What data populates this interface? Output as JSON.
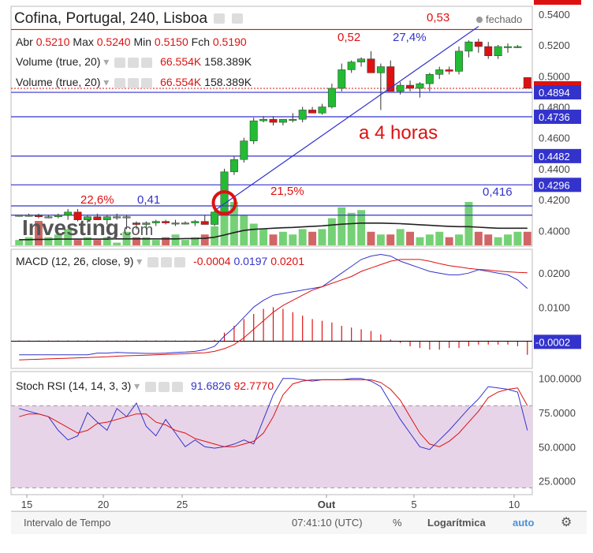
{
  "header": {
    "title": "Cofina, Portugal, 240, Lisboa",
    "status": "fechado",
    "ohlc": {
      "open_label": "Abr",
      "open": "0.5210",
      "high_label": "Max",
      "high": "0.5240",
      "low_label": "Min",
      "low": "0.5150",
      "close_label": "Fch",
      "close": "0.5190"
    },
    "volume_rows": [
      {
        "label": "Volume (true, 20)",
        "v1": "66.554K",
        "v2": "158.389K"
      },
      {
        "label": "Volume (true, 20)",
        "v1": "66.554K",
        "v2": "158.389K"
      }
    ]
  },
  "annotations": {
    "a4horas": "a 4 horas",
    "pct_left": "22,6%",
    "val_041": "0,41",
    "pct_mid": "21,5%",
    "val_0416": "0,416",
    "val_052": "0,52",
    "pct_top": "27,4%",
    "val_053": "0,53"
  },
  "price_tags": [
    {
      "value": "0.5400",
      "price": 0.54,
      "style": "red-top"
    },
    {
      "value": "0.4920",
      "price": 0.492,
      "style": "red"
    },
    {
      "value": "0.4894",
      "price": 0.4894,
      "style": "blue"
    },
    {
      "value": "0.4736",
      "price": 0.4736,
      "style": "blue"
    },
    {
      "value": "0.4482",
      "price": 0.4482,
      "style": "blue"
    },
    {
      "value": "0.4296",
      "price": 0.4296,
      "style": "blue"
    }
  ],
  "watermark": {
    "brand": "Investing",
    "suffix": ".com"
  },
  "macd": {
    "label": "MACD (12, 26, close, 9)",
    "hist": "-0.0004",
    "macd": "0.0197",
    "signal": "0.0201",
    "tag": "-0.0002"
  },
  "stoch": {
    "label": "Stoch RSI (14, 14, 3, 3)",
    "k": "91.6826",
    "d": "92.7770"
  },
  "x_ticks": [
    "15",
    "20",
    "25",
    "Out",
    "5",
    "10"
  ],
  "bottom": {
    "interval": "Intervalo de Tempo",
    "time": "07:41:10 (UTC)",
    "pct": "%",
    "log": "Logarítmica",
    "auto": "auto"
  },
  "colors": {
    "up": "#22bb33",
    "down": "#dd1111",
    "blue": "#3333cc",
    "red": "#dd1111",
    "stoch_fill": "#e8d4e8"
  },
  "chart_data": [
    {
      "type": "candlestick",
      "title": "Cofina, Portugal, 240, Lisboa",
      "ylim": [
        0.39,
        0.545
      ],
      "y_ticks": [
        0.54,
        0.52,
        0.5,
        0.48,
        0.46,
        0.44,
        0.42,
        0.4
      ],
      "h_lines": [
        0.53,
        0.4894,
        0.4736,
        0.4482,
        0.4296,
        0.416,
        0.41
      ],
      "candles": [
        [
          0.41,
          0.41,
          0.409,
          0.41
        ],
        [
          0.41,
          0.411,
          0.409,
          0.41
        ],
        [
          0.41,
          0.411,
          0.408,
          0.409
        ],
        [
          0.409,
          0.41,
          0.408,
          0.409
        ],
        [
          0.409,
          0.411,
          0.408,
          0.41
        ],
        [
          0.41,
          0.414,
          0.407,
          0.412
        ],
        [
          0.412,
          0.414,
          0.406,
          0.407
        ],
        [
          0.407,
          0.41,
          0.405,
          0.409
        ],
        [
          0.409,
          0.411,
          0.407,
          0.407
        ],
        [
          0.407,
          0.41,
          0.404,
          0.409
        ],
        [
          0.409,
          0.411,
          0.407,
          0.409
        ],
        [
          0.409,
          0.41,
          0.401,
          0.409
        ],
        [
          0.405,
          0.406,
          0.401,
          0.404
        ],
        [
          0.404,
          0.406,
          0.401,
          0.405
        ],
        [
          0.405,
          0.407,
          0.403,
          0.406
        ],
        [
          0.406,
          0.407,
          0.404,
          0.405
        ],
        [
          0.405,
          0.407,
          0.403,
          0.405
        ],
        [
          0.405,
          0.406,
          0.404,
          0.405
        ],
        [
          0.405,
          0.407,
          0.403,
          0.406
        ],
        [
          0.406,
          0.41,
          0.404,
          0.404
        ],
        [
          0.404,
          0.414,
          0.403,
          0.412
        ],
        [
          0.412,
          0.44,
          0.41,
          0.438
        ],
        [
          0.438,
          0.448,
          0.436,
          0.446
        ],
        [
          0.446,
          0.46,
          0.444,
          0.458
        ],
        [
          0.458,
          0.473,
          0.456,
          0.471
        ],
        [
          0.471,
          0.474,
          0.47,
          0.472
        ],
        [
          0.472,
          0.474,
          0.468,
          0.47
        ],
        [
          0.47,
          0.472,
          0.468,
          0.472
        ],
        [
          0.472,
          0.476,
          0.47,
          0.472
        ],
        [
          0.472,
          0.48,
          0.47,
          0.478
        ],
        [
          0.478,
          0.48,
          0.476,
          0.476
        ],
        [
          0.476,
          0.482,
          0.475,
          0.48
        ],
        [
          0.48,
          0.495,
          0.479,
          0.492
        ],
        [
          0.492,
          0.508,
          0.49,
          0.504
        ],
        [
          0.504,
          0.51,
          0.502,
          0.509
        ],
        [
          0.509,
          0.512,
          0.506,
          0.511
        ],
        [
          0.511,
          0.516,
          0.509,
          0.502
        ],
        [
          0.502,
          0.508,
          0.478,
          0.506
        ],
        [
          0.506,
          0.51,
          0.49,
          0.49
        ],
        [
          0.49,
          0.496,
          0.488,
          0.494
        ],
        [
          0.494,
          0.497,
          0.49,
          0.492
        ],
        [
          0.492,
          0.496,
          0.486,
          0.495
        ],
        [
          0.495,
          0.502,
          0.49,
          0.501
        ],
        [
          0.501,
          0.506,
          0.498,
          0.504
        ],
        [
          0.504,
          0.506,
          0.501,
          0.503
        ],
        [
          0.503,
          0.519,
          0.501,
          0.516
        ],
        [
          0.516,
          0.523,
          0.512,
          0.522
        ],
        [
          0.522,
          0.524,
          0.515,
          0.519
        ],
        [
          0.519,
          0.522,
          0.511,
          0.513
        ],
        [
          0.513,
          0.52,
          0.511,
          0.519
        ],
        [
          0.519,
          0.521,
          0.515,
          0.519
        ],
        [
          0.519,
          0.52,
          0.518,
          0.519
        ],
        [
          0.499,
          0.499,
          0.492,
          0.492
        ]
      ],
      "volume": [
        2,
        3,
        9,
        3,
        4,
        6,
        2,
        3,
        2,
        3,
        1,
        5,
        3,
        3,
        2,
        3,
        4,
        2,
        3,
        4,
        7,
        13,
        16,
        11,
        8,
        6,
        4,
        5,
        4,
        6,
        5,
        6,
        10,
        14,
        12,
        13,
        5,
        4,
        4,
        6,
        5,
        3,
        4,
        5,
        3,
        4,
        16,
        5,
        4,
        3,
        4,
        5,
        5
      ],
      "volume_ma": [
        2.1,
        2.1,
        2.2,
        2.2,
        2.3,
        2.3,
        2.3,
        2.3,
        2.3,
        2.3,
        2.4,
        2.4,
        2.4,
        2.4,
        2.4,
        2.4,
        2.4,
        2.5,
        2.5,
        2.6,
        3.0,
        3.8,
        4.7,
        5.5,
        5.9,
        6.1,
        6.3,
        6.5,
        6.6,
        6.8,
        7.0,
        7.2,
        7.5,
        7.8,
        8.0,
        8.2,
        8.2,
        8.2,
        8.1,
        8.0,
        7.8,
        7.6,
        7.4,
        7.2,
        7.0,
        6.9,
        6.9,
        6.7,
        6.5,
        6.3,
        6.3,
        6.3,
        6.3
      ]
    },
    {
      "type": "line",
      "title": "MACD (12, 26, close, 9)",
      "ylim": [
        -0.008,
        0.027
      ],
      "y_ticks": [
        0.02,
        0.01
      ],
      "macd": [
        -0.004,
        -0.004,
        -0.004,
        -0.004,
        -0.004,
        -0.004,
        -0.004,
        -0.004,
        -0.0035,
        -0.0035,
        -0.0033,
        -0.0034,
        -0.0035,
        -0.0036,
        -0.0036,
        -0.0035,
        -0.0033,
        -0.0032,
        -0.003,
        -0.0025,
        -0.0015,
        0.0015,
        0.004,
        0.007,
        0.01,
        0.012,
        0.0135,
        0.014,
        0.0145,
        0.015,
        0.0155,
        0.016,
        0.018,
        0.02,
        0.022,
        0.024,
        0.025,
        0.0255,
        0.025,
        0.0235,
        0.0225,
        0.0215,
        0.0205,
        0.02,
        0.0195,
        0.0195,
        0.02,
        0.021,
        0.0205,
        0.02,
        0.0195,
        0.018,
        0.0155
      ],
      "signal": [
        -0.0055,
        -0.0054,
        -0.0053,
        -0.0052,
        -0.0051,
        -0.005,
        -0.0049,
        -0.0048,
        -0.0047,
        -0.0046,
        -0.0044,
        -0.0043,
        -0.0042,
        -0.0041,
        -0.004,
        -0.0039,
        -0.0038,
        -0.0037,
        -0.0035,
        -0.0034,
        -0.003,
        -0.0022,
        -0.001,
        0.001,
        0.0035,
        0.006,
        0.0085,
        0.0105,
        0.012,
        0.0135,
        0.015,
        0.016,
        0.017,
        0.018,
        0.019,
        0.0205,
        0.0215,
        0.0225,
        0.0235,
        0.024,
        0.024,
        0.024,
        0.0235,
        0.0228,
        0.0222,
        0.0218,
        0.0214,
        0.0211,
        0.0209,
        0.0206,
        0.0204,
        0.0202,
        0.0201
      ],
      "hist": [
        0.0002,
        0.0002,
        0.0002,
        0.0002,
        0.0002,
        0.0002,
        0.0002,
        0.0002,
        0.0002,
        0.0002,
        0.0002,
        0.0002,
        0.0002,
        0.0002,
        0.0002,
        0.0002,
        0.0002,
        0.0002,
        0.0002,
        0.0002,
        0.0004,
        0.0025,
        0.0045,
        0.0065,
        0.008,
        0.0095,
        0.01,
        0.0095,
        0.0085,
        0.0075,
        0.0065,
        0.006,
        0.0055,
        0.0045,
        0.004,
        0.0035,
        0.003,
        0.002,
        0.0005,
        -0.0005,
        -0.0015,
        -0.002,
        -0.0025,
        -0.0025,
        -0.002,
        -0.002,
        -0.0015,
        -0.001,
        -0.001,
        -0.001,
        -0.001,
        -0.0015,
        -0.004
      ]
    },
    {
      "type": "line",
      "title": "Stoch RSI (14, 14, 3, 3)",
      "ylim": [
        15,
        105
      ],
      "y_ticks": [
        100,
        75,
        50,
        25
      ],
      "bands": [
        80,
        20
      ],
      "k": [
        78,
        76,
        74,
        72,
        62,
        55,
        58,
        75,
        68,
        62,
        78,
        72,
        82,
        65,
        58,
        70,
        60,
        50,
        55,
        50,
        49,
        50,
        52,
        55,
        52,
        70,
        88,
        100,
        100,
        99,
        98,
        99,
        99,
        99,
        100,
        100,
        98,
        94,
        82,
        70,
        60,
        50,
        48,
        55,
        62,
        70,
        78,
        85,
        94,
        93,
        92,
        90,
        62
      ],
      "d": [
        72,
        74,
        74,
        72,
        68,
        64,
        60,
        62,
        67,
        68,
        70,
        72,
        74,
        74,
        68,
        66,
        62,
        60,
        56,
        54,
        52,
        50,
        50,
        52,
        54,
        60,
        72,
        88,
        96,
        98,
        99,
        99,
        99,
        99,
        99,
        99,
        99,
        97,
        92,
        84,
        72,
        60,
        52,
        50,
        54,
        60,
        68,
        76,
        86,
        90,
        92,
        93,
        80
      ]
    }
  ]
}
